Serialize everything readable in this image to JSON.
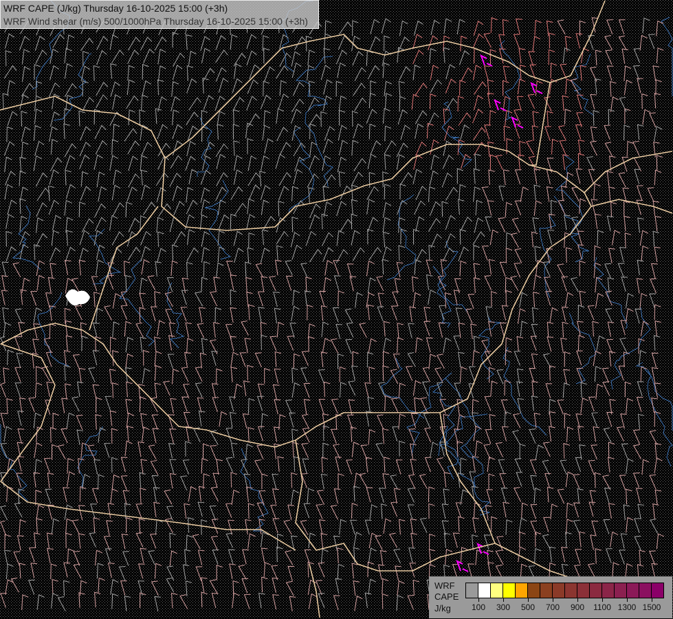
{
  "header": {
    "line1": "WRF CAPE (J/kg) Thursday 16-10-2025 15:00 (+3h)",
    "line2": "WRF Wind shear (m/s) 500/1000hPa Thursday 16-10-2025 15:00 (+3h)"
  },
  "legend": {
    "label1": "WRF",
    "label2": "CAPE",
    "label3": "J/kg",
    "colors": [
      "transparent",
      "#ffffff",
      "#ffff80",
      "#ffff00",
      "#ffa500",
      "#8b4513",
      "#8b4020",
      "#8b3a28",
      "#8b3530",
      "#8b3038",
      "#8b2a40",
      "#8b2548",
      "#8b2050",
      "#8b1a58",
      "#8b1060",
      "#8b0068"
    ],
    "ticks": [
      "100",
      "300",
      "500",
      "700",
      "900",
      "1100",
      "1300",
      "1500"
    ]
  },
  "map_colors": {
    "background": "#000000",
    "border": "#e8c9a0",
    "river": "#3a6fb0",
    "barb_gray": "#9a9a9a",
    "barb_pink": "#c89898",
    "barb_red": "#d07070",
    "barb_magenta": "#ff00ff"
  }
}
